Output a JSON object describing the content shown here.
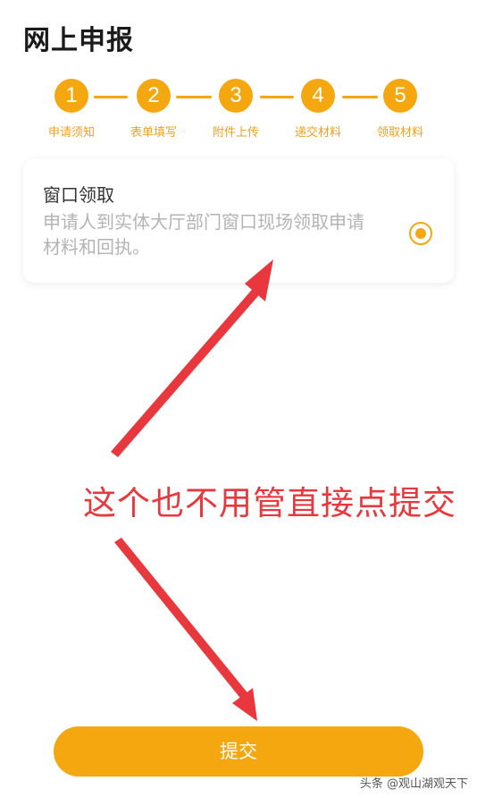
{
  "header": {
    "title": "网上申报"
  },
  "stepper": {
    "steps": [
      {
        "number": "1",
        "label": "申请须知"
      },
      {
        "number": "2",
        "label": "表单填写"
      },
      {
        "number": "3",
        "label": "附件上传"
      },
      {
        "number": "4",
        "label": "递交材料"
      },
      {
        "number": "5",
        "label": "领取材料"
      }
    ],
    "accent_color": "#f5a70f"
  },
  "option": {
    "title": "窗口领取",
    "description": "申请人到实体大厅部门窗口现场领取申请材料和回执。",
    "selected": true
  },
  "annotation": {
    "text": "这个也不用管直接点提交",
    "color": "#e8383d"
  },
  "footer": {
    "submit_label": "提交"
  },
  "watermark": {
    "text": "头条 @观山湖观天下"
  }
}
